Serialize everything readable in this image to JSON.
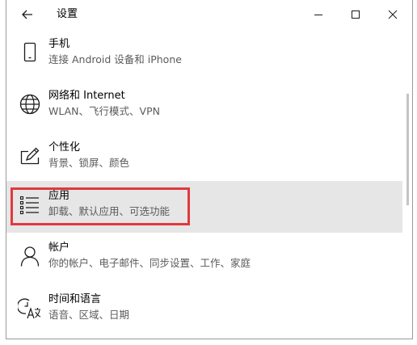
{
  "window": {
    "title": "设置"
  },
  "items": [
    {
      "name": "手机",
      "desc": "连接 Android 设备和 iPhone",
      "icon": "phone-icon"
    },
    {
      "name": "网络和 Internet",
      "desc": "WLAN、飞行模式、VPN",
      "icon": "globe-icon"
    },
    {
      "name": "个性化",
      "desc": "背景、锁屏、颜色",
      "icon": "personalization-pen-icon"
    },
    {
      "name": "应用",
      "desc": "卸载、默认应用、可选功能",
      "icon": "apps-list-icon"
    },
    {
      "name": "帐户",
      "desc": "你的帐户、电子邮件、同步设置、工作、家庭",
      "icon": "person-icon"
    },
    {
      "name": "时间和语言",
      "desc": "语音、区域、日期",
      "icon": "time-language-icon"
    }
  ],
  "colors": {
    "selected_background": "#e6e6e6",
    "highlight_border": "#e0393e",
    "icon": "#1a1a1a"
  }
}
